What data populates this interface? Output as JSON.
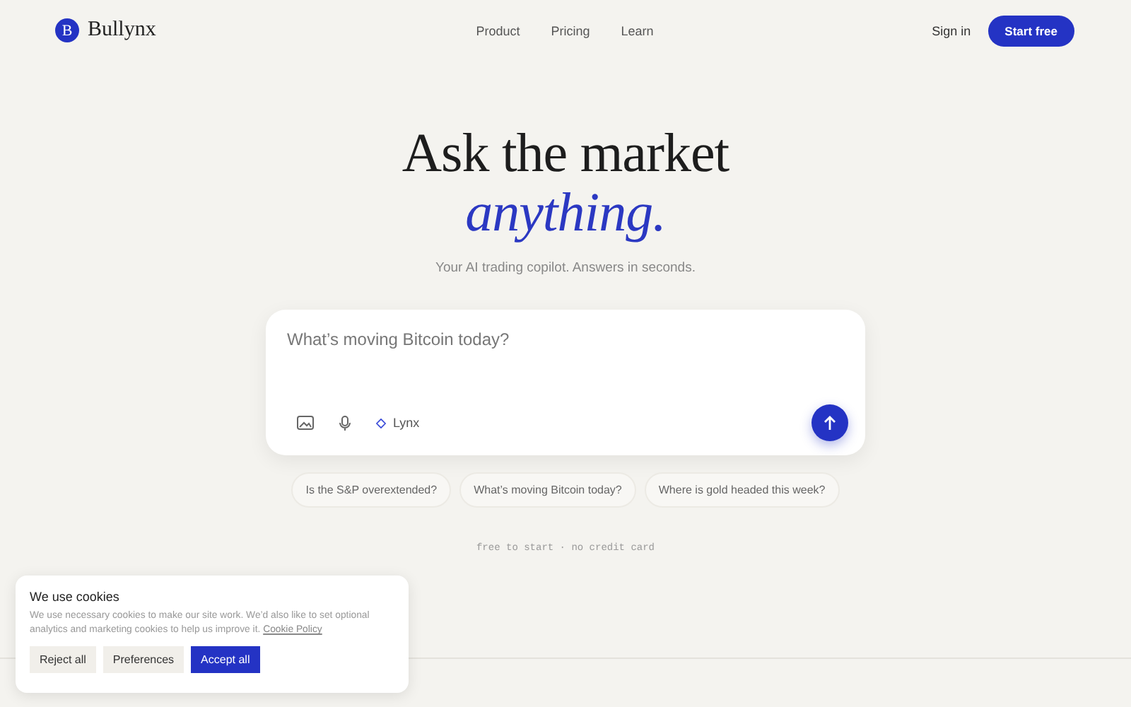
{
  "nav": {
    "logo_mark": "B",
    "brand": "Bullynx",
    "links": [
      "Product",
      "Pricing",
      "Learn"
    ],
    "sign_in": "Sign in",
    "cta": "Start free"
  },
  "hero": {
    "title": "Ask the market",
    "title_accent": "anything.",
    "subtitle": "Your AI trading copilot. Answers in seconds."
  },
  "prompt": {
    "placeholder": "What’s moving Bitcoin today?",
    "model": "Lynx"
  },
  "suggestions": [
    "Is the S&P overextended?",
    "What’s moving Bitcoin today?",
    "Where is gold headed this week?"
  ],
  "note": "free to start · no credit card",
  "cookies": {
    "title": "We use cookies",
    "text": "We use necessary cookies to make our site work. We’d also like to set optional analytics and marketing cookies to help us improve it.",
    "link": "Cookie Policy",
    "buttons": [
      {
        "label": "Reject all",
        "kind": "plain"
      },
      {
        "label": "Preferences",
        "kind": "plain"
      },
      {
        "label": "Accept all",
        "kind": "primary"
      }
    ]
  }
}
